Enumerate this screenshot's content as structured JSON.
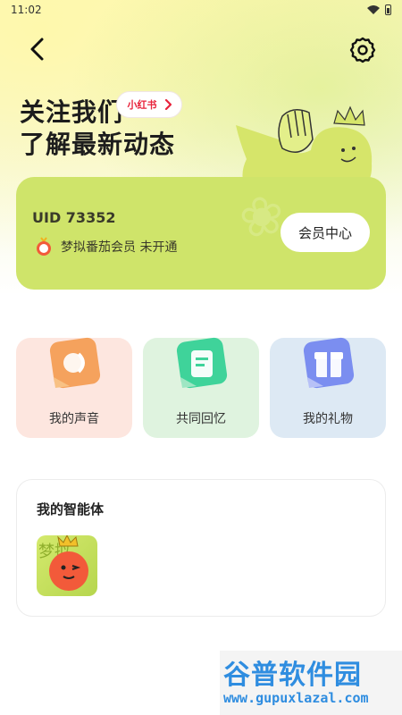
{
  "status_bar": {
    "time": "11:02"
  },
  "promo": {
    "line1": "关注我们",
    "line2": "了解最新动态",
    "xhs_label": "小红书"
  },
  "member": {
    "uid": "UID 73352",
    "status": "梦拟番茄会员 未开通",
    "center_button": "会员中心",
    "card_color": "#cfe46a"
  },
  "features": [
    {
      "label": "我的声音",
      "icon": "voice-icon",
      "color": "#f5a25d"
    },
    {
      "label": "共同回忆",
      "icon": "memory-icon",
      "color": "#3fd39a"
    },
    {
      "label": "我的礼物",
      "icon": "gift-icon",
      "color": "#7b8ef0"
    }
  ],
  "agents": {
    "title": "我的智能体",
    "avatar_text": "梦拟"
  },
  "watermark": {
    "title": "谷普软件园",
    "url": "www.gupuxlazal.com"
  }
}
